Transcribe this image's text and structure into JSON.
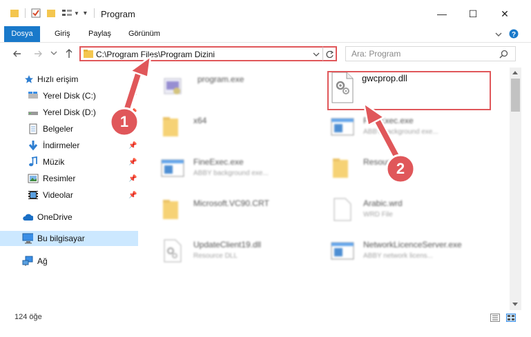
{
  "window": {
    "title": "Program",
    "minimize": "—",
    "maximize": "☐",
    "close": "✕"
  },
  "ribbon": {
    "tabs": [
      "Dosya",
      "Giriş",
      "Paylaş",
      "Görünüm"
    ]
  },
  "address": {
    "path": "C:\\Program Files\\Program Dizini",
    "search_placeholder": "Ara: Program"
  },
  "sidebar": {
    "items": [
      {
        "label": "Hızlı erişim",
        "icon": "star-icon",
        "pinned": false
      },
      {
        "label": "Yerel Disk (C:)",
        "icon": "drive-icon",
        "pinned": true
      },
      {
        "label": "Yerel Disk (D:)",
        "icon": "drive-icon",
        "pinned": true
      },
      {
        "label": "Belgeler",
        "icon": "documents-icon",
        "pinned": true
      },
      {
        "label": "İndirmeler",
        "icon": "downloads-icon",
        "pinned": true
      },
      {
        "label": "Müzik",
        "icon": "music-icon",
        "pinned": true
      },
      {
        "label": "Resimler",
        "icon": "pictures-icon",
        "pinned": true
      },
      {
        "label": "Videolar",
        "icon": "videos-icon",
        "pinned": true
      },
      {
        "label": "OneDrive",
        "icon": "cloud-icon",
        "pinned": false
      },
      {
        "label": "Bu bilgisayar",
        "icon": "computer-icon",
        "pinned": false
      },
      {
        "label": "Ağ",
        "icon": "network-icon",
        "pinned": false
      }
    ]
  },
  "files": [
    {
      "name": "program.exe",
      "sub": "",
      "icon": "exe-icon"
    },
    {
      "name": "gwcprop.dll",
      "sub": "",
      "icon": "dll-icon"
    },
    {
      "name": "x64",
      "sub": "",
      "icon": "folder-icon"
    },
    {
      "name": "FineExec.exe",
      "sub": "ABBY background exe...",
      "icon": "app-window-icon"
    },
    {
      "name": "FineExec.exe",
      "sub": "ABBY background exe...",
      "icon": "app-window-icon"
    },
    {
      "name": "Resources",
      "sub": "",
      "icon": "folder-icon"
    },
    {
      "name": "Microsoft.VC90.CRT",
      "sub": "",
      "icon": "folder-icon"
    },
    {
      "name": "Arabic.wrd",
      "sub": "WRD File",
      "icon": "file-icon"
    },
    {
      "name": "UpdateClient19.dll",
      "sub": "Resource DLL",
      "icon": "dll-icon"
    },
    {
      "name": "NetworkLicenceServer.exe",
      "sub": "ABBY network licens...",
      "icon": "app-window-icon"
    }
  ],
  "status": {
    "count": "124 öğe"
  },
  "annotations": {
    "marker1": "1",
    "marker2": "2"
  },
  "colors": {
    "accent": "#1979ca",
    "highlight": "#e0575a",
    "selected": "#cce8ff",
    "folder": "#f4c64f"
  }
}
